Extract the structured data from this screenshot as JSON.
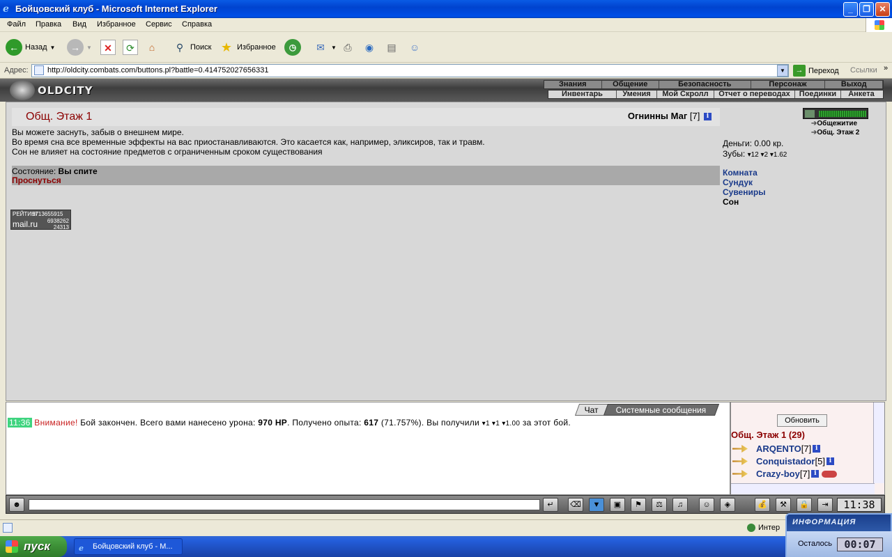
{
  "window": {
    "title": "Бойцовский клуб - Microsoft Internet Explorer",
    "minimize": "_",
    "maximize": "❐",
    "close": "✕"
  },
  "menu": [
    "Файл",
    "Правка",
    "Вид",
    "Избранное",
    "Сервис",
    "Справка"
  ],
  "toolbar": {
    "back": "Назад",
    "search": "Поиск",
    "favorites": "Избранное"
  },
  "address": {
    "label": "Адрес:",
    "url": "http://oldcity.combats.com/buttons.pl?battle=0.414752027656331",
    "go": "Переход",
    "links": "Ссылки"
  },
  "game": {
    "logo": "OLDCITY",
    "topnav": [
      "Знания",
      "Общение",
      "Безопасность",
      "Персонаж",
      "Выход"
    ],
    "subnav": [
      "Инвентарь",
      "Умения",
      "Мой Скролл",
      "Отчет о переводах",
      "Поединки",
      "Анкета"
    ]
  },
  "room": {
    "title": "Общ. Этаж 1",
    "user_name": "Огнинны Маг",
    "user_level": "[7]",
    "messages": [
      "Вы можете заснуть, забыв о внешнем мире.",
      "Во время сна все временные эффекты на вас приостанавливаются. Это касается как, например, эликсиров, так и травм.",
      "Сон не влияет на состояние предметов с ограниченным сроком существования"
    ],
    "state_label": "Состояние: ",
    "state_value": "Вы спите",
    "wake": "Проснуться"
  },
  "counter": {
    "label": "РЕЙТИНГ",
    "n1": "1713655915",
    "brand": "mail.ru",
    "n2": "6938262",
    "n3": "24313"
  },
  "right": {
    "nav1": "Общежитие",
    "nav2": "Общ. Этаж 2",
    "money": "Деньги: 0.00 кр.",
    "teeth_label": "Зубы: ",
    "teeth": "12 ",
    "teeth2": "2 ",
    "teeth3": "1.62",
    "menu": [
      "Комната",
      "Сундук",
      "Сувениры",
      "Сон"
    ]
  },
  "chat": {
    "tab_chat": "Чат",
    "tab_sys": "Системные сообщения",
    "time": "11:36",
    "warn": "Внимание!",
    "t1": " Бой закончен. Всего вами нанесено урона: ",
    "dmg": "970 HP",
    "t2": ". Получено опыта: ",
    "exp": "617",
    "t3": " (71.757%). Вы получили ",
    "r1": "1 ",
    "r2": "1 ",
    "r3": "1.00",
    "t4": " за этот бой."
  },
  "online": {
    "refresh": "Обновить",
    "room": "Общ. Этаж 1 (29)",
    "users": [
      {
        "name": "ARQENTO",
        "level": "[7]"
      },
      {
        "name": "Conquistador",
        "level": "[5]"
      },
      {
        "name": "Crazy-boy",
        "level": "[7]"
      }
    ]
  },
  "inputbar": {
    "clock": "11:38"
  },
  "statusbar": {
    "zone": "Интер"
  },
  "taskbar": {
    "start": "пуск",
    "task": "Бойцовский клуб - M..."
  },
  "widget": {
    "title": "ИНФОРМАЦИЯ",
    "remaining_label": "Осталось",
    "timer": "00:07"
  }
}
